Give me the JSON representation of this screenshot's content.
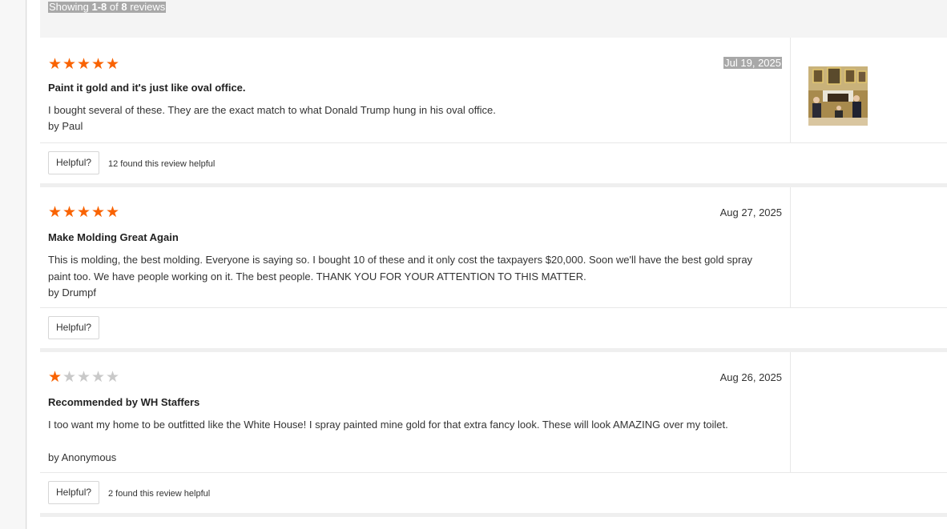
{
  "summary": {
    "prefix": "Showing ",
    "range": "1-8",
    "middle": " of ",
    "total": "8",
    "suffix": " reviews"
  },
  "reviews": [
    {
      "rating": 5,
      "date": "Jul 19, 2025",
      "title": "Paint it gold and it's just like oval office.",
      "text": "I bought several of these. They are the exact match to what Donald Trump hung in his oval office.",
      "by_label": "by",
      "author": "Paul",
      "helpful_label": "Helpful?",
      "helpful_count": "12 found this review helpful",
      "has_photo": true,
      "photo_icon": "oval-office-photo"
    },
    {
      "rating": 5,
      "date": "Aug 27, 2025",
      "title": "Make Molding Great Again",
      "text": "This is molding, the best molding. Everyone is saying so. I bought 10 of these and it only cost the taxpayers $20,000. Soon we'll have the best gold spray paint too. We have people working on it. The best people. THANK YOU FOR YOUR ATTENTION TO THIS MATTER.",
      "by_label": "by",
      "author": "Drumpf",
      "helpful_label": "Helpful?",
      "helpful_count": ""
    },
    {
      "rating": 1,
      "date": "Aug 26, 2025",
      "title": "Recommended by WH Staffers",
      "text": "I too want my home to be outfitted like the White House! I spray painted mine gold for that extra fancy look. These will look AMAZING over my toilet.",
      "by_label": "by",
      "author": "Anonymous",
      "helpful_label": "Helpful?",
      "helpful_count": "2 found this review helpful"
    }
  ],
  "colors": {
    "star_on": "#f96302",
    "star_off": "#c9c9c9",
    "highlight": "#a8a8a8"
  }
}
